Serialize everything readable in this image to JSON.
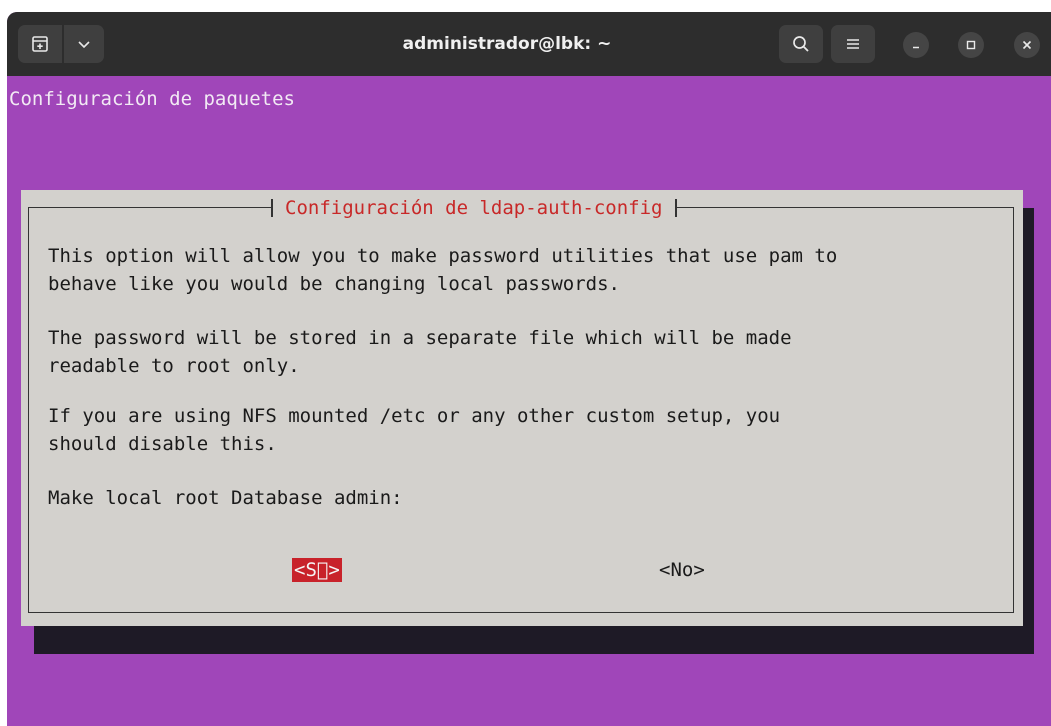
{
  "window": {
    "title": "administrador@lbk: ~"
  },
  "terminal": {
    "header_line": "Configuración de paquetes",
    "dialog": {
      "title": "Configuración de ldap-auth-config",
      "paragraphs": [
        "This option will allow you to make password utilities that use pam to\nbehave like you would be changing local passwords.",
        "The password will be stored in a separate file which will be made\nreadable to root only.",
        "If you are using NFS mounted /etc or any other custom setup, you\nshould disable this.",
        "Make local root Database admin:"
      ],
      "yes_label": "<S\u0000>",
      "no_label": "<No>"
    }
  },
  "icons": {
    "new_tab": "new-tab-icon",
    "tab_menu": "chevron-down-icon",
    "search": "search-icon",
    "menu": "hamburger-menu-icon",
    "minimize": "minimize-icon",
    "maximize": "maximize-icon",
    "close": "close-icon"
  },
  "colors": {
    "terminal_bg": "#a046b9",
    "dialog_bg": "#d3d1cd",
    "title_red": "#c82828",
    "selected_button_bg": "#c8222a",
    "titlebar_bg": "#2d2d2d"
  }
}
